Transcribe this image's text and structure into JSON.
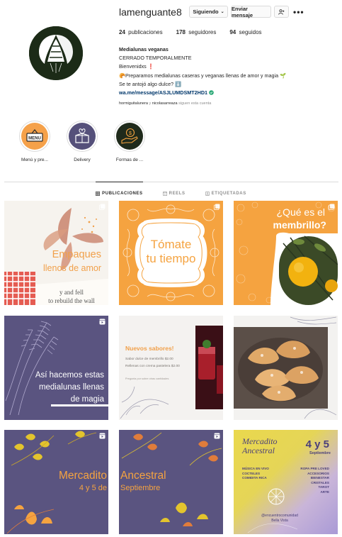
{
  "profile": {
    "username": "lamenguante8",
    "following_button": "Siguiendo",
    "message_button": "Enviar mensaje",
    "stats": {
      "posts_count": "24",
      "posts_label": "publicaciones",
      "followers_count": "178",
      "followers_label": "seguidores",
      "following_count": "94",
      "following_label": "seguidos"
    },
    "bio": {
      "name": "Medialunas veganas",
      "line1": "CERRADO TEMPORALMENTE",
      "line2": "Bienvenidxs ❗",
      "line3": "🥐Preparamos medialunas caseras y veganas llenas de amor y magia 🌱",
      "line4": "Se te antojó algo dulce? ⬇️",
      "link": "wa.me/message/ASJLUMDSMT2HD1",
      "followed_by_1": "hormiguitalunera",
      "followed_by_sep": " y ",
      "followed_by_2": "nicolasarreaza",
      "followed_by_suffix": " siguen esta cuenta"
    }
  },
  "highlights": [
    {
      "label": "Menú y pre...",
      "icon": "menu-sign-icon",
      "bg": "#f5a14a"
    },
    {
      "label": "Delivery",
      "icon": "gift-box-icon",
      "bg": "#55507a"
    },
    {
      "label": "Formas de ...",
      "icon": "money-hand-icon",
      "bg": "#1f2a1b"
    }
  ],
  "tabs": [
    {
      "label": "PUBLICACIONES",
      "icon": "grid-icon",
      "active": true
    },
    {
      "label": "REELS",
      "icon": "reels-icon",
      "active": false
    },
    {
      "label": "ETIQUETADAS",
      "icon": "tag-icon",
      "active": false
    }
  ],
  "posts": [
    {
      "lines": [
        "Empaques",
        "llenos de amor"
      ],
      "bg": "#f6f3ee",
      "fg": "#f1a04a"
    },
    {
      "lines": [
        "Tómate",
        "tu tiempo"
      ],
      "bg": "#f5a340",
      "fg": "#ffffff"
    },
    {
      "lines": [
        "¿Qué es el",
        "membrillo?"
      ],
      "bg": "#f5a340",
      "fg": "#ffffff"
    },
    {
      "lines": [
        "Así hacemos estas",
        "medialunas llenas",
        "de magia"
      ],
      "bg": "#5a5480",
      "fg": "#ffffff"
    },
    {
      "title": "Nuevos sabores!",
      "lines": [
        "Sabor dulce de membrillo $2.00",
        "Rellenas con crema pastelera $2.00",
        "Pregunta por sobre otras cantidades"
      ],
      "bg": "#f4f2f0",
      "fg": "#f1a04a"
    },
    {
      "lines": [],
      "bg": "#f3f2f0",
      "fg": "#000000"
    },
    {
      "lines": [
        "Mercadito",
        "4 y 5 de"
      ],
      "bg": "#5a5480",
      "fg": "#f5a340"
    },
    {
      "lines": [
        "Ancestral",
        "Septiembre"
      ],
      "bg": "#5a5480",
      "fg": "#f5a340"
    },
    {
      "title": "Mercadito Ancestral",
      "date": "4 y 5",
      "month": "Septiembre",
      "left_list": [
        "MÚSICA EN VIVO",
        "COCTELES",
        "COMIDITA RICA"
      ],
      "right_list": [
        "ROPA PRE LOVED",
        "ACCESORIOS",
        "BIENESTAR",
        "CRISTALES",
        "TAROT",
        "ARTE"
      ],
      "footer": [
        "@encuentrocomunidad",
        "Bella Vista"
      ],
      "bg": "#e9d44a",
      "fg": "#4a3f7a"
    }
  ],
  "colors": {
    "accent": "#f5a340",
    "link": "#00376b",
    "purple": "#5a5480"
  }
}
